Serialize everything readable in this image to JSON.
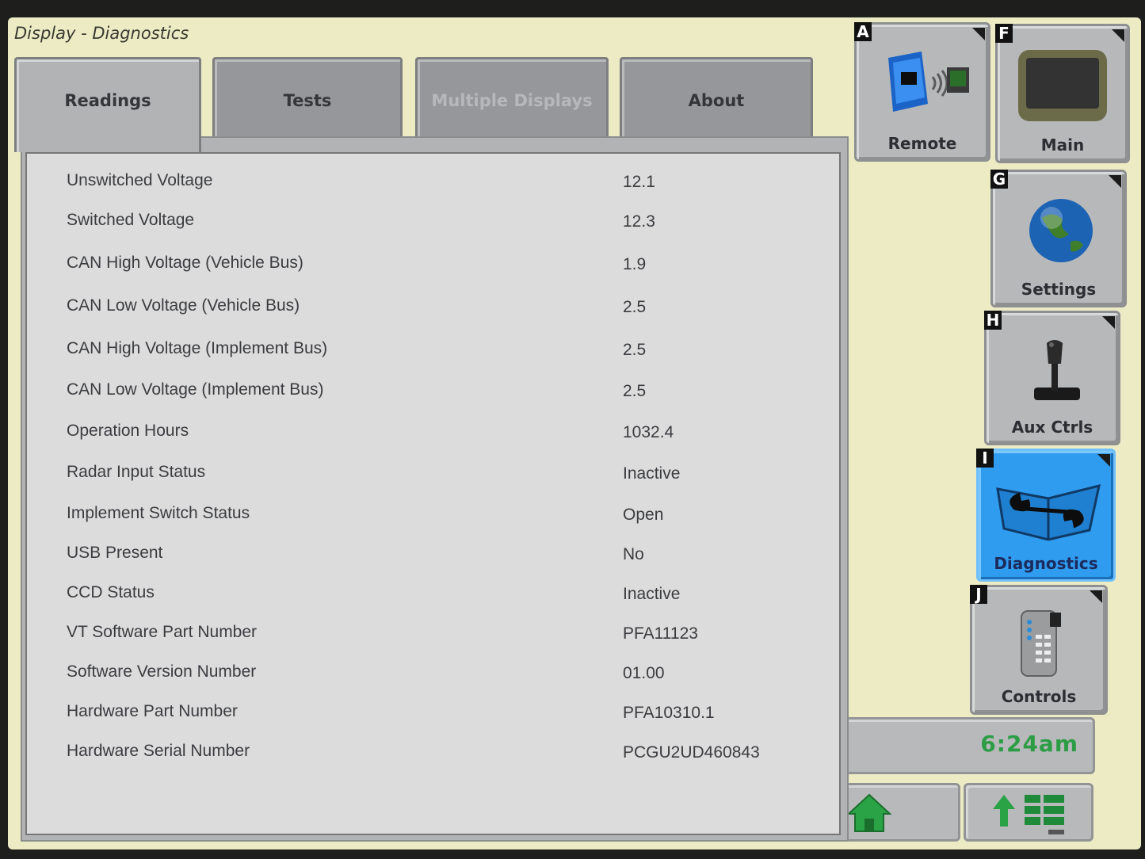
{
  "window": {
    "title": "Display - Diagnostics"
  },
  "tabs": [
    {
      "label": "Readings",
      "state": "active"
    },
    {
      "label": "Tests",
      "state": "normal"
    },
    {
      "label": "Multiple Displays",
      "state": "disabled"
    },
    {
      "label": "About",
      "state": "normal"
    }
  ],
  "readings": [
    {
      "label": "Unswitched Voltage",
      "value": "12.1"
    },
    {
      "label": "Switched Voltage",
      "value": "12.3"
    },
    {
      "label": "CAN High Voltage (Vehicle Bus)",
      "value": "1.9"
    },
    {
      "label": "CAN Low Voltage (Vehicle Bus)",
      "value": "2.5"
    },
    {
      "label": "CAN High Voltage (Implement Bus)",
      "value": "2.5"
    },
    {
      "label": "CAN Low Voltage (Implement Bus)",
      "value": "2.5"
    },
    {
      "label": "Operation Hours",
      "value": "1032.4"
    },
    {
      "label": "Radar Input Status",
      "value": "Inactive"
    },
    {
      "label": "Implement Switch Status",
      "value": "Open"
    },
    {
      "label": "USB Present",
      "value": "No"
    },
    {
      "label": "CCD Status",
      "value": "Inactive"
    },
    {
      "label": "VT Software Part Number",
      "value": "PFA11123"
    },
    {
      "label": "Software Version Number",
      "value": "01.00"
    },
    {
      "label": "Hardware Part Number",
      "value": "PFA10310.1"
    },
    {
      "label": "Hardware Serial Number",
      "value": "PCGU2UD460843"
    }
  ],
  "sidebar": {
    "remote": {
      "letter": "A",
      "label": "Remote",
      "icon": "remote-display-icon"
    },
    "main": {
      "letter": "F",
      "label": "Main",
      "icon": "display-screen-icon"
    },
    "settings": {
      "letter": "G",
      "label": "Settings",
      "icon": "globe-icon"
    },
    "aux": {
      "letter": "H",
      "label": "Aux Ctrls",
      "icon": "joystick-icon"
    },
    "diagnostics": {
      "letter": "I",
      "label": "Diagnostics",
      "icon": "wrench-book-icon"
    },
    "controls": {
      "letter": "J",
      "label": "Controls",
      "icon": "keypad-icon"
    }
  },
  "clock": "6:24am",
  "bottom": {
    "home_icon": "home-icon",
    "menu_icon": "up-arrow-menu-icon"
  },
  "colors": {
    "screen_bg": "#ecebc4",
    "tab_bg": "#95979a",
    "active_bg": "#b1b3b5",
    "diagnostics_active": "#2f9cf0",
    "clock_text": "#2d9d45"
  }
}
